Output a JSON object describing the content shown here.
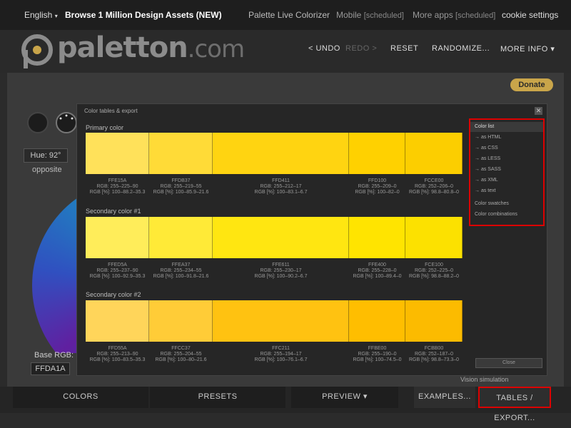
{
  "top_bar": {
    "language": "English",
    "language_caret": "▾",
    "promo": "Browse 1 Million Design Assets (NEW)",
    "paletton_overlap": "Palette Live Colorizer",
    "mobile": "Mobile",
    "mobile_tag": "[scheduled]",
    "more_apps": "More apps",
    "more_apps_tag": "[scheduled]",
    "cookie": "cookie settings"
  },
  "header": {
    "logo_main": "paletton",
    "logo_dot": ".com",
    "undo": "< UNDO",
    "redo": "REDO >",
    "reset": "RESET",
    "randomize": "RANDOMIZE...",
    "more_info": "MORE INFO ▾"
  },
  "left_panel": {
    "hue": "Hue: 92°",
    "opposite": "opposite",
    "base_rgb_label": "Base RGB:",
    "base_rgb_value": "FFDA1A"
  },
  "donate": "Donate",
  "modal": {
    "title": "Color tables & export",
    "close_x": "✕",
    "close_button": "Close",
    "sections": [
      {
        "label": "Primary color",
        "swatches": [
          {
            "hex": "FFE15A",
            "rgb": "RGB: 255–225–90",
            "pct": "RGB [%]: 100–88.2–35.3",
            "color": "#FFE15A"
          },
          {
            "hex": "FFDB37",
            "rgb": "RGB: 255–219–55",
            "pct": "RGB [%]: 100–85.9–21.6",
            "color": "#FFDB37"
          },
          {
            "hex": "FFD411",
            "rgb": "RGB: 255–212–17",
            "pct": "RGB [%]: 100–83.1–6.7",
            "color": "#FFD411"
          },
          {
            "hex": "FFD100",
            "rgb": "RGB: 255–209–0",
            "pct": "RGB [%]: 100–82–0",
            "color": "#FFD100"
          },
          {
            "hex": "FCCE00",
            "rgb": "RGB: 252–206–0",
            "pct": "RGB [%]: 98.8–80.8–0",
            "color": "#FCCE00"
          }
        ]
      },
      {
        "label": "Secondary color #1",
        "swatches": [
          {
            "hex": "FFED5A",
            "rgb": "RGB: 255–237–90",
            "pct": "RGB [%]: 100–92.9–35.3",
            "color": "#FFED5A"
          },
          {
            "hex": "FFEA37",
            "rgb": "RGB: 255–234–55",
            "pct": "RGB [%]: 100–91.8–21.6",
            "color": "#FFEA37"
          },
          {
            "hex": "FFE611",
            "rgb": "RGB: 255–230–17",
            "pct": "RGB [%]: 100–90.2–6.7",
            "color": "#FFE611"
          },
          {
            "hex": "FFE400",
            "rgb": "RGB: 255–228–0",
            "pct": "RGB [%]: 100–89.4–0",
            "color": "#FFE400"
          },
          {
            "hex": "FCE100",
            "rgb": "RGB: 252–225–0",
            "pct": "RGB [%]: 98.8–88.2–0",
            "color": "#FCE100"
          }
        ]
      },
      {
        "label": "Secondary color #2",
        "swatches": [
          {
            "hex": "FFD55A",
            "rgb": "RGB: 255–213–90",
            "pct": "RGB [%]: 100–83.5–35.3",
            "color": "#FFD55A"
          },
          {
            "hex": "FFCC37",
            "rgb": "RGB: 255–204–55",
            "pct": "RGB [%]: 100–80–21.6",
            "color": "#FFCC37"
          },
          {
            "hex": "FFC211",
            "rgb": "RGB: 255–194–17",
            "pct": "RGB [%]: 100–76.1–6.7",
            "color": "#FFC211"
          },
          {
            "hex": "FFBE00",
            "rgb": "RGB: 255–190–0",
            "pct": "RGB [%]: 100–74.5–0",
            "color": "#FFBE00"
          },
          {
            "hex": "FCBB00",
            "rgb": "RGB: 252–187–0",
            "pct": "RGB [%]: 98.8–73.3–0",
            "color": "#FCBB00"
          }
        ]
      }
    ],
    "menu": [
      "Color list",
      "→ as HTML",
      "→ as CSS",
      "→ as LESS",
      "→ as SASS",
      "→ as XML",
      "→ as text",
      "Color swatches",
      "Color combinations"
    ]
  },
  "vision_label": "Vision simulation",
  "bottom_tabs": {
    "colors": "COLORS",
    "presets": "PRESETS",
    "preview": "PREVIEW ▾",
    "examples": "EXAMPLES...",
    "tables": "TABLES / EXPORT..."
  }
}
